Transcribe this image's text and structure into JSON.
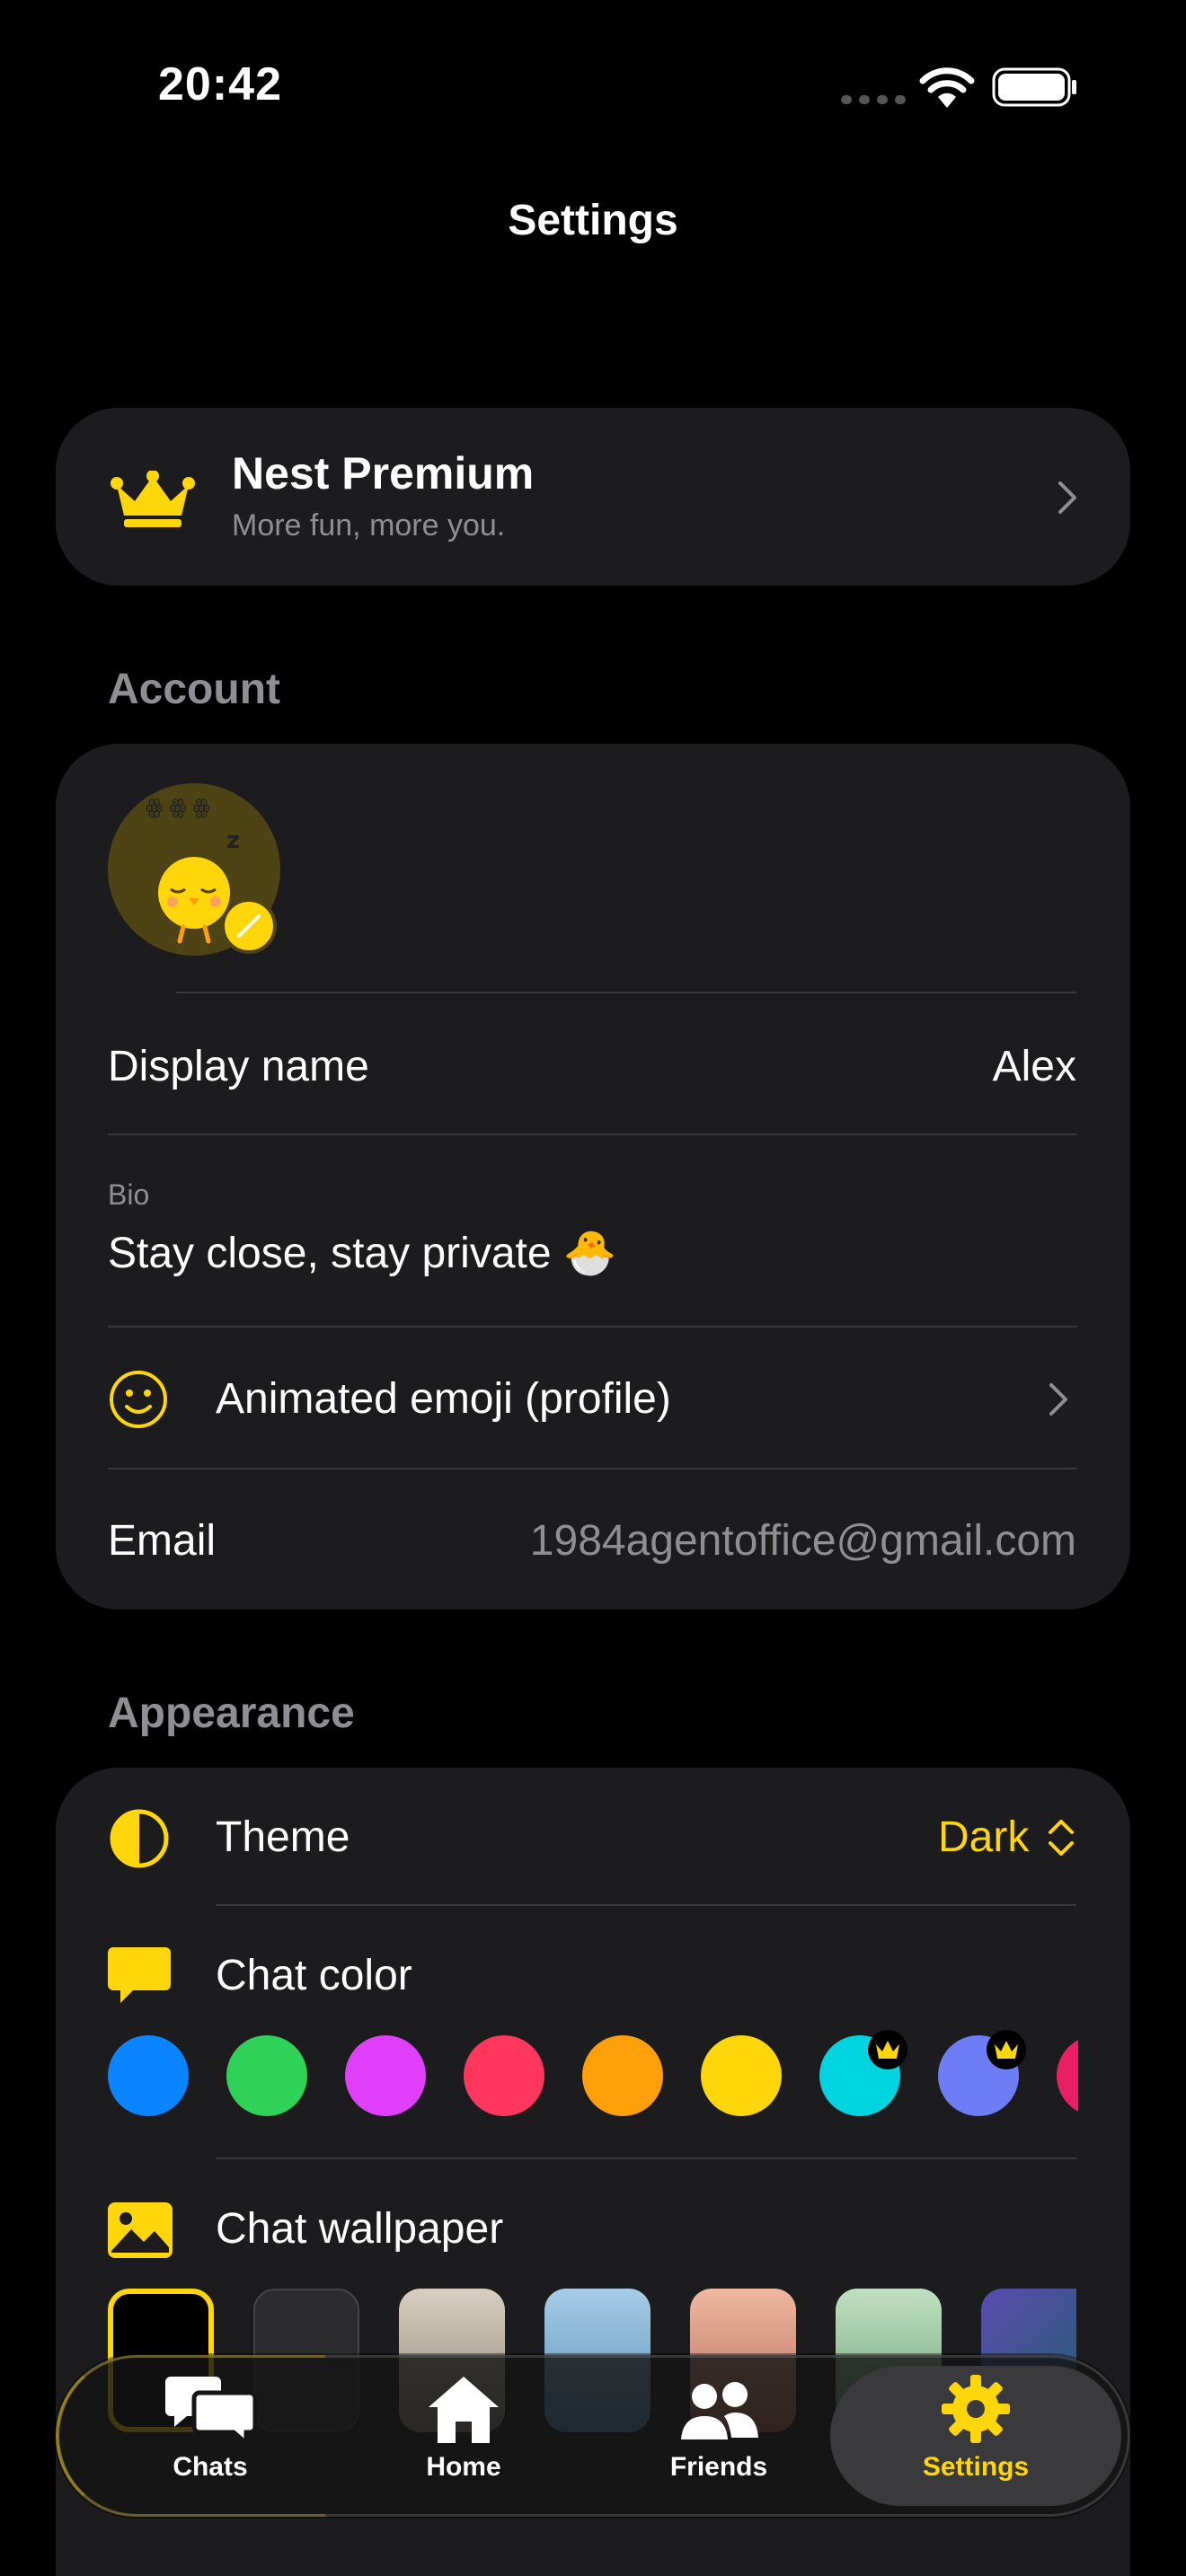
{
  "status": {
    "time": "20:42"
  },
  "header": {
    "title": "Settings"
  },
  "premium": {
    "title": "Nest Premium",
    "subtitle": "More fun, more you."
  },
  "account": {
    "section_title": "Account",
    "display_name_label": "Display name",
    "display_name_value": "Alex",
    "bio_label": "Bio",
    "bio_value": "Stay close, stay private 🐣",
    "animated_emoji_label": "Animated emoji (profile)",
    "email_label": "Email",
    "email_value": "1984agentoffice@gmail.com"
  },
  "appearance": {
    "section_title": "Appearance",
    "theme_label": "Theme",
    "theme_value": "Dark",
    "chat_color_label": "Chat color",
    "chat_colors": [
      "#0a84ff",
      "#30d158",
      "#e040fb",
      "#ff375f",
      "#ff9f0a",
      "#ffd60a",
      "#00d4e0",
      "#6e7cf5",
      "#e91e63"
    ],
    "chat_wallpaper_label": "Chat wallpaper"
  },
  "tabs": [
    {
      "label": "Chats",
      "icon": "chats-icon"
    },
    {
      "label": "Home",
      "icon": "home-icon"
    },
    {
      "label": "Friends",
      "icon": "friends-icon"
    },
    {
      "label": "Settings",
      "icon": "gear-icon",
      "active": true
    }
  ],
  "accent_color": "#ffd60a"
}
